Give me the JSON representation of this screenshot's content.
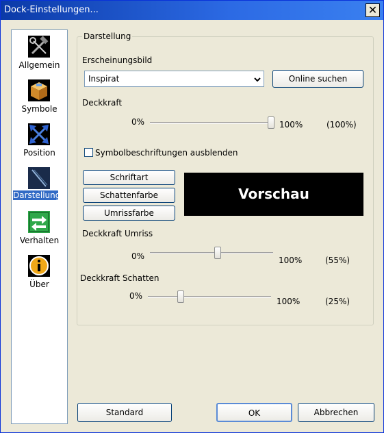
{
  "window": {
    "title": "Dock-Einstellungen...",
    "close_glyph": "✕"
  },
  "sidebar": {
    "items": [
      {
        "label": "Allgemein",
        "icon": "tools-icon"
      },
      {
        "label": "Symbole",
        "icon": "package-icon"
      },
      {
        "label": "Position",
        "icon": "arrows-icon"
      },
      {
        "label": "Darstellung",
        "icon": "brush-icon",
        "selected": true
      },
      {
        "label": "Verhalten",
        "icon": "green-arrows-icon"
      },
      {
        "label": "Über",
        "icon": "info-icon"
      }
    ]
  },
  "group": {
    "title": "Darstellung",
    "appearance_label": "Erscheinungsbild",
    "appearance_value": "Inspirat",
    "online_button": "Online suchen",
    "opacity_label": "Deckkraft",
    "opacity_min": "0%",
    "opacity_max": "100%",
    "opacity_value": "(100%)",
    "opacity_level": 1.0,
    "hide_labels_checkbox": "Symbolbeschriftungen ausblenden",
    "hide_labels_checked": false,
    "font_button": "Schriftart",
    "shadow_color_button": "Schattenfarbe",
    "outline_color_button": "Umrissfarbe",
    "preview_text": "Vorschau",
    "outline_opacity_label": "Deckkraft Umriss",
    "outline_min": "0%",
    "outline_max": "100%",
    "outline_value": "(55%)",
    "outline_level": 0.55,
    "shadow_opacity_label": "Deckkraft Schatten",
    "shadow_min": "0%",
    "shadow_max": "100%",
    "shadow_value": "(25%)",
    "shadow_level": 0.25
  },
  "footer": {
    "standard_button": "Standard",
    "ok_button": "OK",
    "cancel_button": "Abbrechen"
  },
  "colors": {
    "accent": "#316ac5",
    "titlebar": "#0b3aa8",
    "dialog_bg": "#ece9d8",
    "preview_bg": "#000000"
  }
}
